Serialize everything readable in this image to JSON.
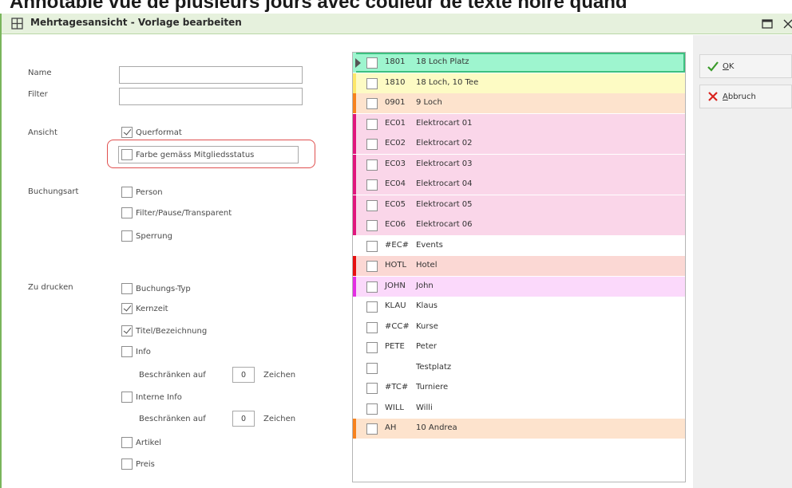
{
  "caption": "Annotable vue de plusieurs jours avec couleur de texte noire quand",
  "window": {
    "title": "Mehrtagesansicht - Vorlage bearbeiten"
  },
  "form": {
    "name_label": "Name",
    "name_value": "",
    "filter_label": "Filter",
    "filter_value": "",
    "ansicht_label": "Ansicht",
    "querformat_label": "Querformat",
    "querformat_checked": true,
    "farbe_label": "Farbe gemäss Mitgliedsstatus",
    "farbe_checked": false,
    "buchungsart_label": "Buchungsart",
    "person_label": "Person",
    "person_checked": false,
    "filter_pause_label": "Filter/Pause/Transparent",
    "filter_pause_checked": false,
    "sperrung_label": "Sperrung",
    "sperrung_checked": false,
    "zu_drucken_label": "Zu drucken",
    "buchungs_typ_label": "Buchungs-Typ",
    "buchungs_typ_checked": false,
    "kernzeit_label": "Kernzeit",
    "kernzeit_checked": true,
    "titel_label": "Titel/Bezeichnung",
    "titel_checked": true,
    "info_label": "Info",
    "info_checked": false,
    "beschraenken_label_1": "Beschränken auf",
    "beschraenken_value_1": "0",
    "zeichen_label_1": "Zeichen",
    "interne_info_label": "Interne Info",
    "interne_info_checked": false,
    "beschraenken_label_2": "Beschränken auf",
    "beschraenken_value_2": "0",
    "zeichen_label_2": "Zeichen",
    "artikel_label": "Artikel",
    "artikel_checked": false,
    "preis_label": "Preis",
    "preis_checked": false
  },
  "list": [
    {
      "code": "1801",
      "name": "18 Loch Platz",
      "bg": "#9ef5cf",
      "bar": "#9ef5cf",
      "active": true
    },
    {
      "code": "1810",
      "name": "18 Loch, 10 Tee",
      "bg": "#fdfbc4",
      "bar": "#fde76a",
      "active": false
    },
    {
      "code": "0901",
      "name": "9 Loch",
      "bg": "#fde3cd",
      "bar": "#f7821d",
      "active": false
    },
    {
      "code": "EC01",
      "name": "Elektrocart 01",
      "bg": "#fad6e9",
      "bar": "#e0167d",
      "active": false
    },
    {
      "code": "EC02",
      "name": "Elektrocart 02",
      "bg": "#fad6e9",
      "bar": "#e0167d",
      "active": false
    },
    {
      "code": "EC03",
      "name": "Elektrocart 03",
      "bg": "#fad6e9",
      "bar": "#e0167d",
      "active": false
    },
    {
      "code": "EC04",
      "name": "Elektrocart 04",
      "bg": "#fad6e9",
      "bar": "#e0167d",
      "active": false
    },
    {
      "code": "EC05",
      "name": "Elektrocart 05",
      "bg": "#fad6e9",
      "bar": "#e0167d",
      "active": false
    },
    {
      "code": "EC06",
      "name": "Elektrocart 06",
      "bg": "#fad6e9",
      "bar": "#e0167d",
      "active": false
    },
    {
      "code": "#EC#",
      "name": "Events",
      "bg": "#ffffff",
      "bar": "#ffffff",
      "active": false
    },
    {
      "code": "HOTL",
      "name": "Hotel",
      "bg": "#fbd8d4",
      "bar": "#e61010",
      "active": false
    },
    {
      "code": "JOHN",
      "name": "John",
      "bg": "#fbd9fb",
      "bar": "#e32ee3",
      "active": false
    },
    {
      "code": "KLAU",
      "name": "Klaus",
      "bg": "#ffffff",
      "bar": "#ffffff",
      "active": false
    },
    {
      "code": "#CC#",
      "name": "Kurse",
      "bg": "#ffffff",
      "bar": "#ffffff",
      "active": false
    },
    {
      "code": "PETE",
      "name": "Peter",
      "bg": "#ffffff",
      "bar": "#ffffff",
      "active": false
    },
    {
      "code": "",
      "name": "Testplatz",
      "bg": "#ffffff",
      "bar": "#ffffff",
      "active": false
    },
    {
      "code": "#TC#",
      "name": "Turniere",
      "bg": "#ffffff",
      "bar": "#ffffff",
      "active": false
    },
    {
      "code": "WILL",
      "name": "Willi",
      "bg": "#ffffff",
      "bar": "#ffffff",
      "active": false
    },
    {
      "code": "AH",
      "name": "10 Andrea",
      "bg": "#fde3cd",
      "bar": "#f7821d",
      "active": false
    }
  ],
  "buttons": {
    "ok_first": "O",
    "ok_rest": "K",
    "abbruch_first": "A",
    "abbruch_rest": "bbruch"
  },
  "icons": {
    "title": "grid-icon",
    "maximize": "maximize-icon",
    "close": "close-icon",
    "ok": "checkmark-icon",
    "cancel": "cross-icon"
  },
  "colors": {
    "accent_green": "#7ab55c",
    "highlight_red": "#e0504f",
    "ok_green": "#3a9a2a",
    "cancel_red": "#d9221c"
  }
}
